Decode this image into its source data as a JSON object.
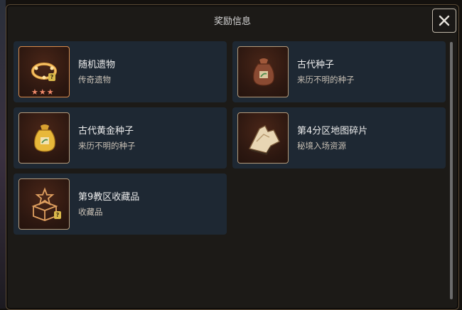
{
  "dialog": {
    "title": "奖励信息",
    "close_icon": "close-icon"
  },
  "rewards": [
    {
      "name": "随机遗物",
      "desc": "传奇遗物",
      "icon": "bracelet-icon",
      "stars": 3,
      "star_glyph": "★",
      "badge": "?"
    },
    {
      "name": "古代种子",
      "desc": "来历不明的种子",
      "icon": "seed-bag-icon"
    },
    {
      "name": "古代黄金种子",
      "desc": "来历不明的种子",
      "icon": "golden-seed-bag-icon"
    },
    {
      "name": "第4分区地图碎片",
      "desc": "秘境入场资源",
      "icon": "map-fragment-icon"
    },
    {
      "name": "第9教区收藏品",
      "desc": "收藏品",
      "icon": "collectible-box-icon",
      "badge": "?"
    }
  ],
  "colors": {
    "panel": "#1c1a17",
    "card": "#1e2833",
    "accent_border": "#d98a4a",
    "star": "#f08a6a"
  }
}
